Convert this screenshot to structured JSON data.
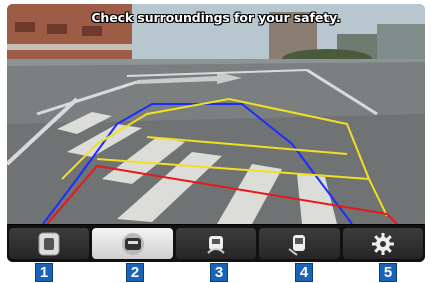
{
  "camera": {
    "warning_text": "Check surroundings for your safety."
  },
  "toolbar": {
    "buttons": [
      {
        "icon": "top-view-icon",
        "active": false
      },
      {
        "icon": "rear-view-icon",
        "active": true
      },
      {
        "icon": "rear-wide-view-icon",
        "active": false
      },
      {
        "icon": "side-view-icon",
        "active": false
      },
      {
        "icon": "settings-icon",
        "active": false
      }
    ]
  },
  "callouts": [
    "1",
    "2",
    "3",
    "4",
    "5"
  ],
  "colors": {
    "callout_blue": "#1a63b8",
    "guide_blue": "#1e2cff",
    "guide_yellow": "#f0e020",
    "guide_red": "#e81818"
  }
}
